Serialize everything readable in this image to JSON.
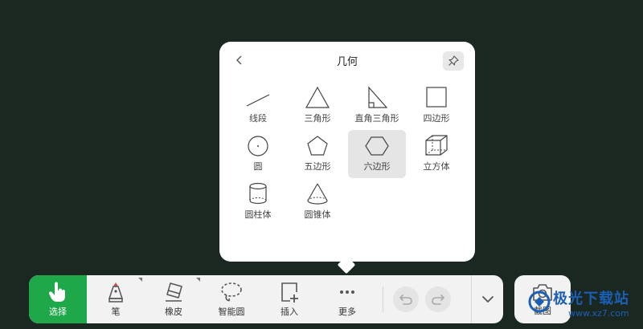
{
  "popup": {
    "title": "几何",
    "shapes": [
      {
        "label": "线段",
        "icon": "line-segment-icon"
      },
      {
        "label": "三角形",
        "icon": "triangle-icon"
      },
      {
        "label": "直角三角形",
        "icon": "right-triangle-icon"
      },
      {
        "label": "四边形",
        "icon": "quadrilateral-icon"
      },
      {
        "label": "圆",
        "icon": "circle-icon"
      },
      {
        "label": "五边形",
        "icon": "pentagon-icon"
      },
      {
        "label": "六边形",
        "icon": "hexagon-icon"
      },
      {
        "label": "立方体",
        "icon": "cube-icon"
      },
      {
        "label": "圆柱体",
        "icon": "cylinder-icon"
      },
      {
        "label": "圆锥体",
        "icon": "cone-icon"
      }
    ],
    "selected": "六边形"
  },
  "toolbar": {
    "tools": [
      {
        "label": "选择",
        "icon": "hand-pointer-icon"
      },
      {
        "label": "笔",
        "icon": "pen-icon"
      },
      {
        "label": "橡皮",
        "icon": "eraser-icon"
      },
      {
        "label": "智能圆",
        "icon": "smart-lasso-icon"
      },
      {
        "label": "插入",
        "icon": "insert-icon"
      },
      {
        "label": "更多",
        "icon": "more-icon"
      }
    ],
    "screenshot_label": "截图"
  },
  "watermark": {
    "text": "极光下载站",
    "url": "www.xz7.com"
  },
  "colors": {
    "background": "#1b2822",
    "accent": "#1ea84a",
    "pen_tip": "#e8403a",
    "watermark": "#1a5fb4"
  }
}
